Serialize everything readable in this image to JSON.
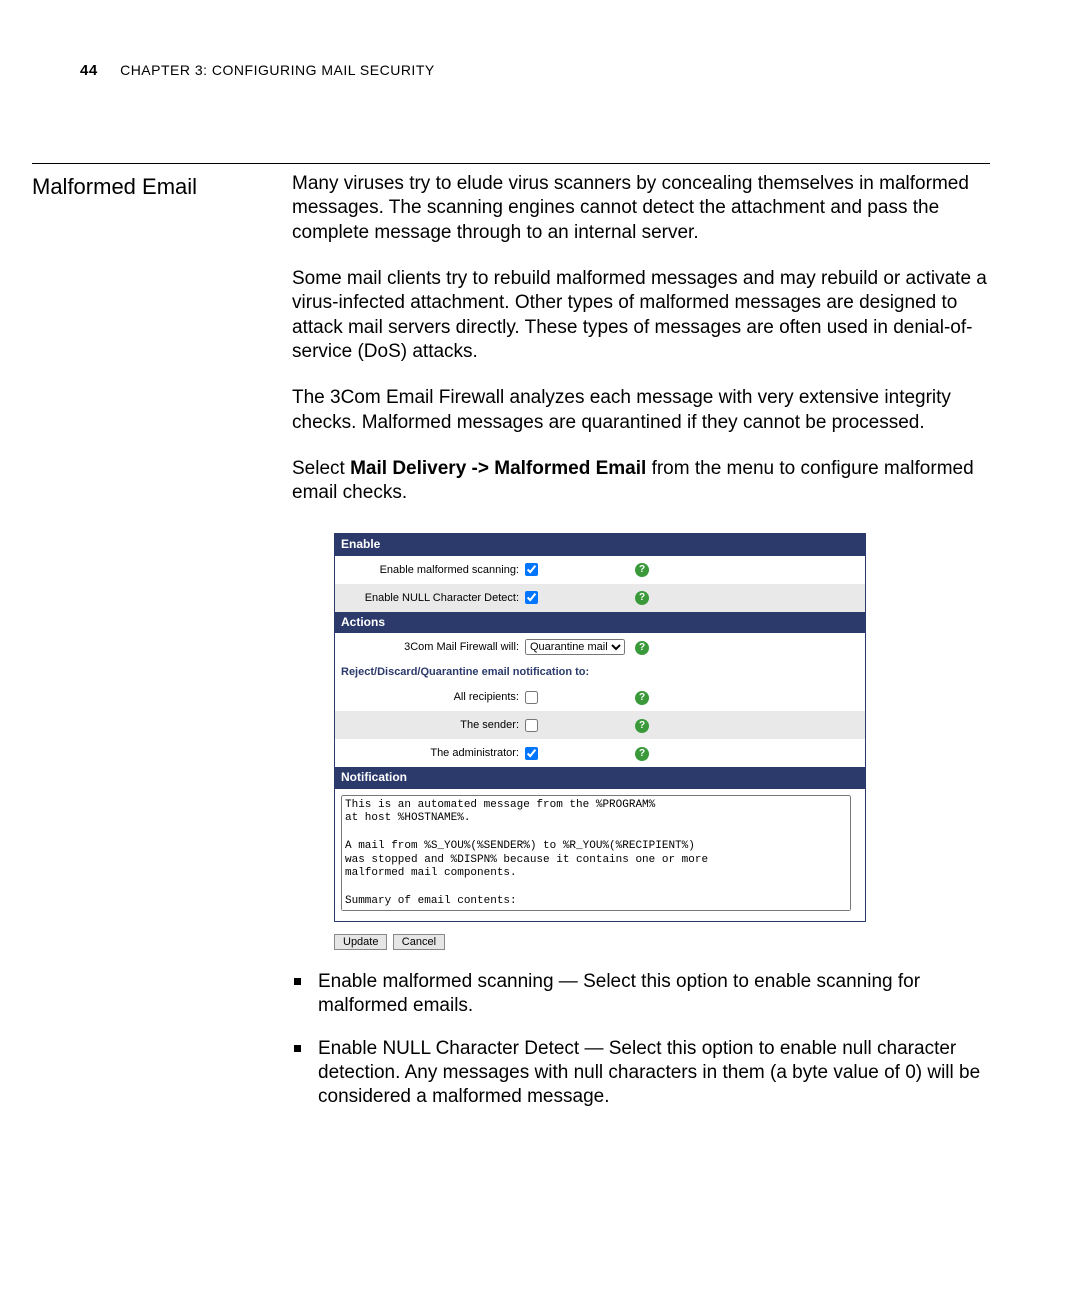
{
  "header": {
    "page_number": "44",
    "chapter": "Chapter 3: Configuring Mail Security"
  },
  "section": {
    "title": "Malformed Email"
  },
  "paragraphs": {
    "p1": "Many viruses try to elude virus scanners by concealing themselves in malformed messages. The scanning engines cannot detect the attachment and pass the complete message through to an internal server.",
    "p2": "Some mail clients try to rebuild malformed messages and may rebuild or activate a virus-infected attachment. Other types of malformed messages are designed to attack mail servers directly. These types of messages are often used in denial-of-service (DoS) attacks.",
    "p3": "The 3Com Email Firewall analyzes each message with very extensive integrity checks. Malformed messages are quarantined if they cannot be processed.",
    "p4_lead": "Select ",
    "p4_path": "Mail Delivery -> Malformed Email",
    "p4_tail": " from the menu to configure malformed email checks."
  },
  "panel": {
    "enable_header": "Enable",
    "enable_scanning_label": "Enable malformed scanning:",
    "enable_null_label": "Enable NULL Character Detect:",
    "actions_header": "Actions",
    "firewall_will_label": "3Com Mail Firewall will:",
    "firewall_will_value": "Quarantine mail",
    "notify_subheader": "Reject/Discard/Quarantine email notification to:",
    "all_recipients_label": "All recipients:",
    "sender_label": "The sender:",
    "admin_label": "The administrator:",
    "notification_header": "Notification",
    "notification_text": "This is an automated message from the %PROGRAM%\nat host %HOSTNAME%.\n\nA mail from %S_YOU%(%SENDER%) to %R_YOU%(%RECIPIENT%)\nwas stopped and %DISPN% because it contains one or more\nmalformed mail components.\n\nSummary of email contents:",
    "update_btn": "Update",
    "cancel_btn": "Cancel"
  },
  "bullets": {
    "b1": "Enable malformed scanning — Select this option to enable scanning for malformed emails.",
    "b2": "Enable NULL Character Detect — Select this option to enable null character detection. Any messages with null characters in them (a byte value of 0) will be considered a malformed message."
  }
}
